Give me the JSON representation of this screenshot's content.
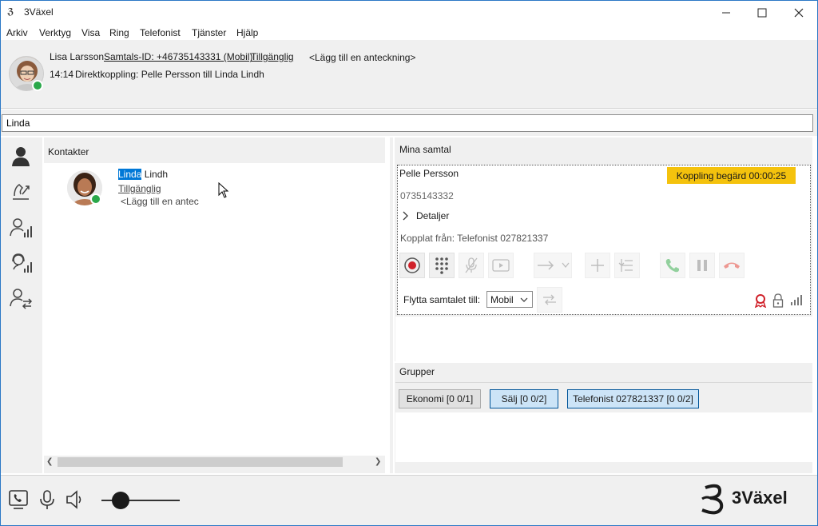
{
  "window": {
    "title": "3Växel"
  },
  "menu": [
    "Arkiv",
    "Verktyg",
    "Visa",
    "Ring",
    "Telefonist",
    "Tjänster",
    "Hjälp"
  ],
  "user": {
    "name": "Lisa Larsson",
    "call_id": "Samtals-ID: +46735143331 (Mobil)",
    "status": "Tillgänglig",
    "note": "<Lägg till en anteckning>",
    "event_time": "14:14",
    "event_text": "Direktkoppling: Pelle Persson till Linda Lindh"
  },
  "search": {
    "value": "Linda"
  },
  "contacts": {
    "title": "Kontakter",
    "items": [
      {
        "first": "Linda",
        "last": "Lindh",
        "status": "Tillgänglig",
        "note": "<Lägg till en antec"
      }
    ]
  },
  "calls": {
    "title": "Mina samtal",
    "caller": "Pelle Persson",
    "number": "0735143332",
    "status_badge": "Koppling begärd 00:00:25",
    "details_label": "Detaljer",
    "transferred_from": "Kopplat från: Telefonist 027821337",
    "move_label": "Flytta samtalet till:",
    "move_target": "Mobil"
  },
  "groups": {
    "title": "Grupper",
    "items": [
      {
        "label": "Ekonomi [0 0/1]"
      },
      {
        "label": "Sälj [0 0/2]"
      },
      {
        "label": "Telefonist 027821337 [0 0/2]"
      }
    ]
  },
  "brand": {
    "logo_text": "3Växel"
  },
  "colors": {
    "available": "#2aa84a",
    "badge": "#f4c20d",
    "record": "#d0212a",
    "group_selected": "#cce4f7"
  }
}
